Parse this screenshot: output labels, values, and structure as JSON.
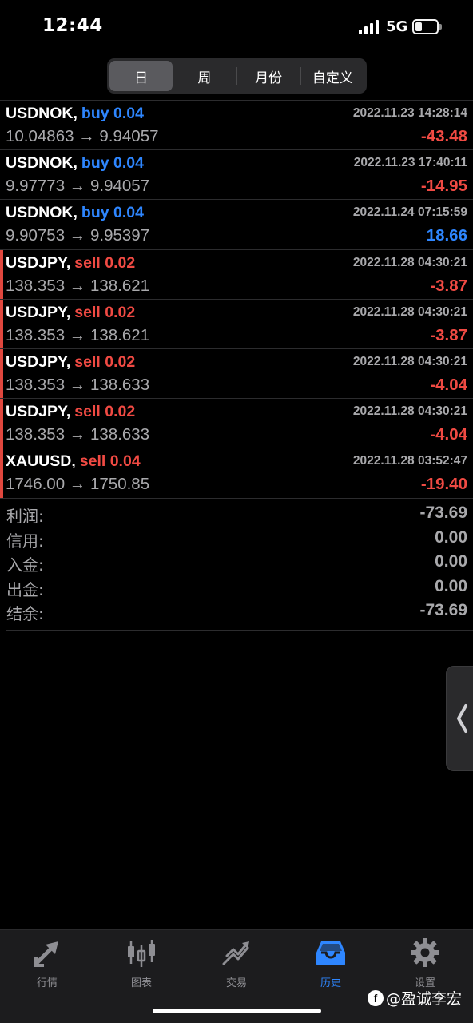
{
  "status_bar": {
    "time": "12:44",
    "network": "5G"
  },
  "tabs_segment": [
    {
      "label": "日",
      "active": true
    },
    {
      "label": "周",
      "active": false
    },
    {
      "label": "月份",
      "active": false
    },
    {
      "label": "自定义",
      "active": false
    }
  ],
  "trades": [
    {
      "symbol": "USDNOK,",
      "side": "buy",
      "side_label": "buy 0.04",
      "prices": "10.04863 → 9.94057",
      "time": "2022.11.23 14:28:14",
      "profit": "-43.48"
    },
    {
      "symbol": "USDNOK,",
      "side": "buy",
      "side_label": "buy 0.04",
      "prices": "9.97773 → 9.94057",
      "time": "2022.11.23 17:40:11",
      "profit": "-14.95"
    },
    {
      "symbol": "USDNOK,",
      "side": "buy",
      "side_label": "buy 0.04",
      "prices": "9.90753 → 9.95397",
      "time": "2022.11.24 07:15:59",
      "profit": "18.66"
    },
    {
      "symbol": "USDJPY,",
      "side": "sell",
      "side_label": "sell 0.02",
      "prices": "138.353 → 138.621",
      "time": "2022.11.28 04:30:21",
      "profit": "-3.87"
    },
    {
      "symbol": "USDJPY,",
      "side": "sell",
      "side_label": "sell 0.02",
      "prices": "138.353 → 138.621",
      "time": "2022.11.28 04:30:21",
      "profit": "-3.87"
    },
    {
      "symbol": "USDJPY,",
      "side": "sell",
      "side_label": "sell 0.02",
      "prices": "138.353 → 138.633",
      "time": "2022.11.28 04:30:21",
      "profit": "-4.04"
    },
    {
      "symbol": "USDJPY,",
      "side": "sell",
      "side_label": "sell 0.02",
      "prices": "138.353 → 138.633",
      "time": "2022.11.28 04:30:21",
      "profit": "-4.04"
    },
    {
      "symbol": "XAUUSD,",
      "side": "sell",
      "side_label": "sell 0.04",
      "prices": "1746.00 → 1750.85",
      "time": "2022.11.28 03:52:47",
      "profit": "-19.40"
    }
  ],
  "summary": [
    {
      "label": "利润:",
      "value": "-73.69"
    },
    {
      "label": "信用:",
      "value": "0.00"
    },
    {
      "label": "入金:",
      "value": "0.00"
    },
    {
      "label": "出金:",
      "value": "0.00"
    },
    {
      "label": "结余:",
      "value": "-73.69"
    }
  ],
  "bottom_tabs": [
    {
      "label": "行情",
      "icon": "quotes-arrows-icon",
      "active": false
    },
    {
      "label": "图表",
      "icon": "candlestick-chart-icon",
      "active": false
    },
    {
      "label": "交易",
      "icon": "trade-trend-icon",
      "active": false
    },
    {
      "label": "历史",
      "icon": "history-inbox-icon",
      "active": true
    },
    {
      "label": "设置",
      "icon": "gear-icon",
      "active": false
    }
  ],
  "watermark": {
    "text": "@盈诚李宏"
  },
  "colors": {
    "buy": "#2e86ff",
    "sell": "#f04a43",
    "active_tab": "#2e86ff",
    "muted": "#a9a9ac"
  }
}
